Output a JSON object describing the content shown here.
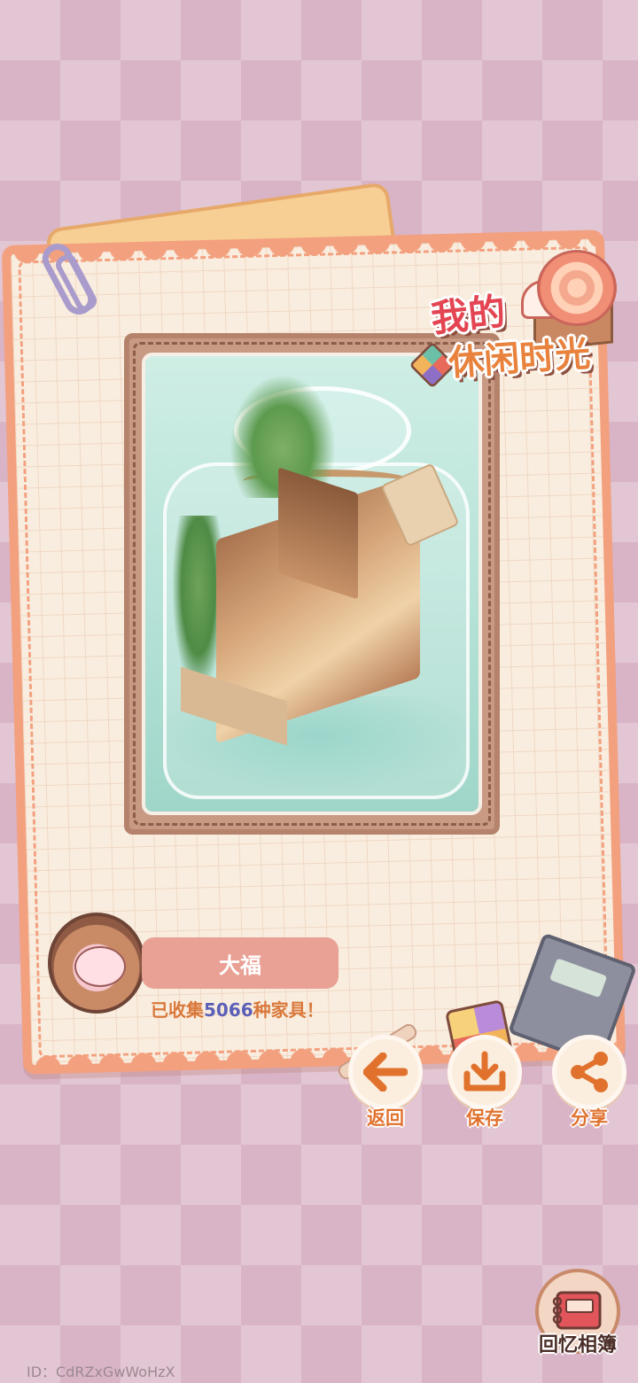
{
  "title_sticker": {
    "line1": "我的",
    "line2": "休闲时光"
  },
  "player": {
    "name": "大福",
    "collect_prefix": "已收集",
    "collect_count": "5066",
    "collect_suffix": "种家具！"
  },
  "actions": {
    "back_label": "返回",
    "save_label": "保存",
    "share_label": "分享"
  },
  "album": {
    "label": "回忆相簿"
  },
  "footer": {
    "id_text": "ID：CdRZxGwWoHzX"
  },
  "colors": {
    "accent_orange": "#e1722e",
    "frame_border": "#f3a07e",
    "count_blue": "#5b5fb7",
    "name_pill": "#e9a195"
  },
  "icons": [
    "arrow-left-icon",
    "download-icon",
    "share-icon",
    "album-book-icon"
  ]
}
